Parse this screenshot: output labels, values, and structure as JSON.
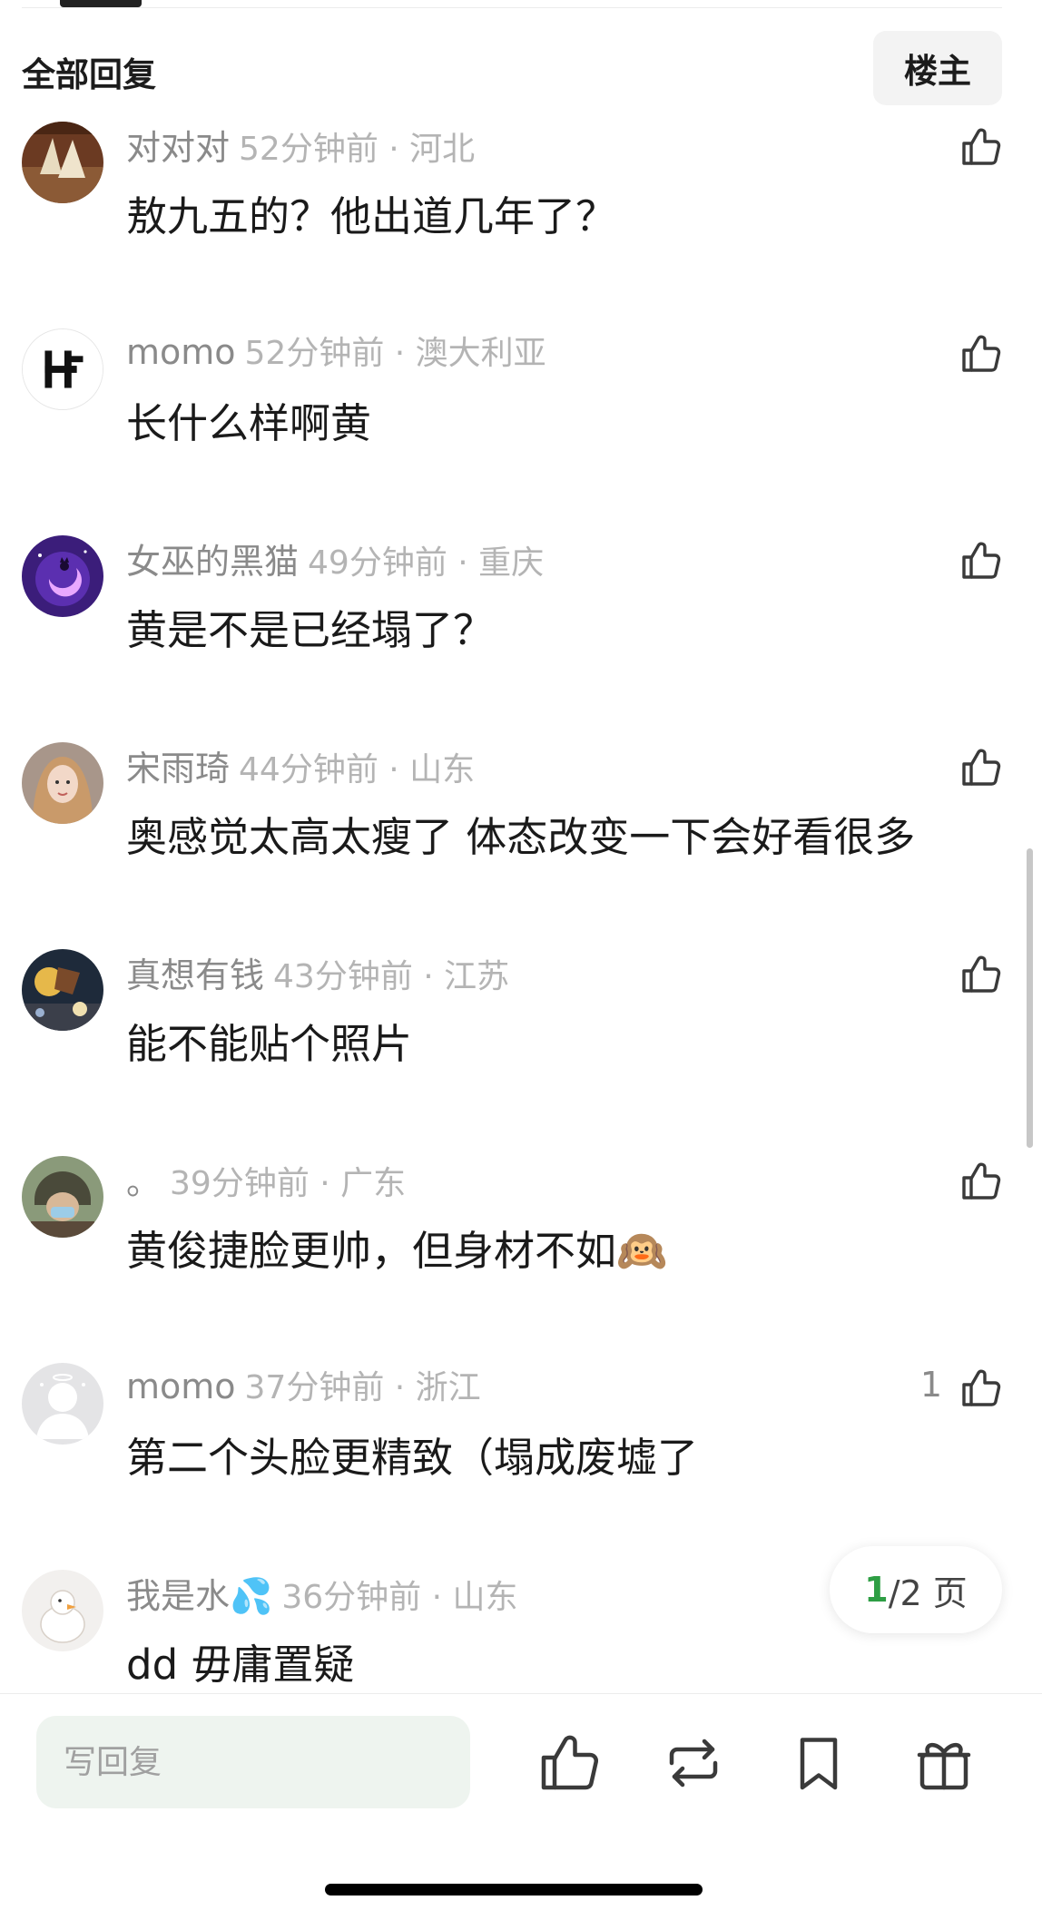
{
  "header": {
    "title": "全部回复",
    "op_button": "楼主"
  },
  "comments": [
    {
      "username": "对对对",
      "time": "52分钟前 · 河北",
      "text": "敖九五的？他出道几年了？",
      "likes": ""
    },
    {
      "username": "momo",
      "time": "52分钟前 · 澳大利亚",
      "text": "长什么样啊黄",
      "likes": ""
    },
    {
      "username": "女巫的黑猫",
      "time": "49分钟前 · 重庆",
      "text": "黄是不是已经塌了？",
      "likes": ""
    },
    {
      "username": "宋雨琦",
      "time": "44分钟前 · 山东",
      "text": "奥感觉太高太瘦了 体态改变一下会好看很多",
      "likes": ""
    },
    {
      "username": "真想有钱",
      "time": "43分钟前 · 江苏",
      "text": "能不能贴个照片",
      "likes": ""
    },
    {
      "username": "。",
      "time": "39分钟前 · 广东",
      "text": "黄俊捷脸更帅，但身材不如🙉",
      "likes": ""
    },
    {
      "username": "momo",
      "time": "37分钟前 · 浙江",
      "text": "第二个头脸更精致（塌成废墟了",
      "likes": "1"
    },
    {
      "username": "我是水💦",
      "time": "36分钟前 · 山东",
      "text": "dd 毋庸置疑",
      "likes": ""
    }
  ],
  "pagination": {
    "current": "1",
    "total_text": "/2 页"
  },
  "bottom": {
    "reply_placeholder": "写回复"
  }
}
